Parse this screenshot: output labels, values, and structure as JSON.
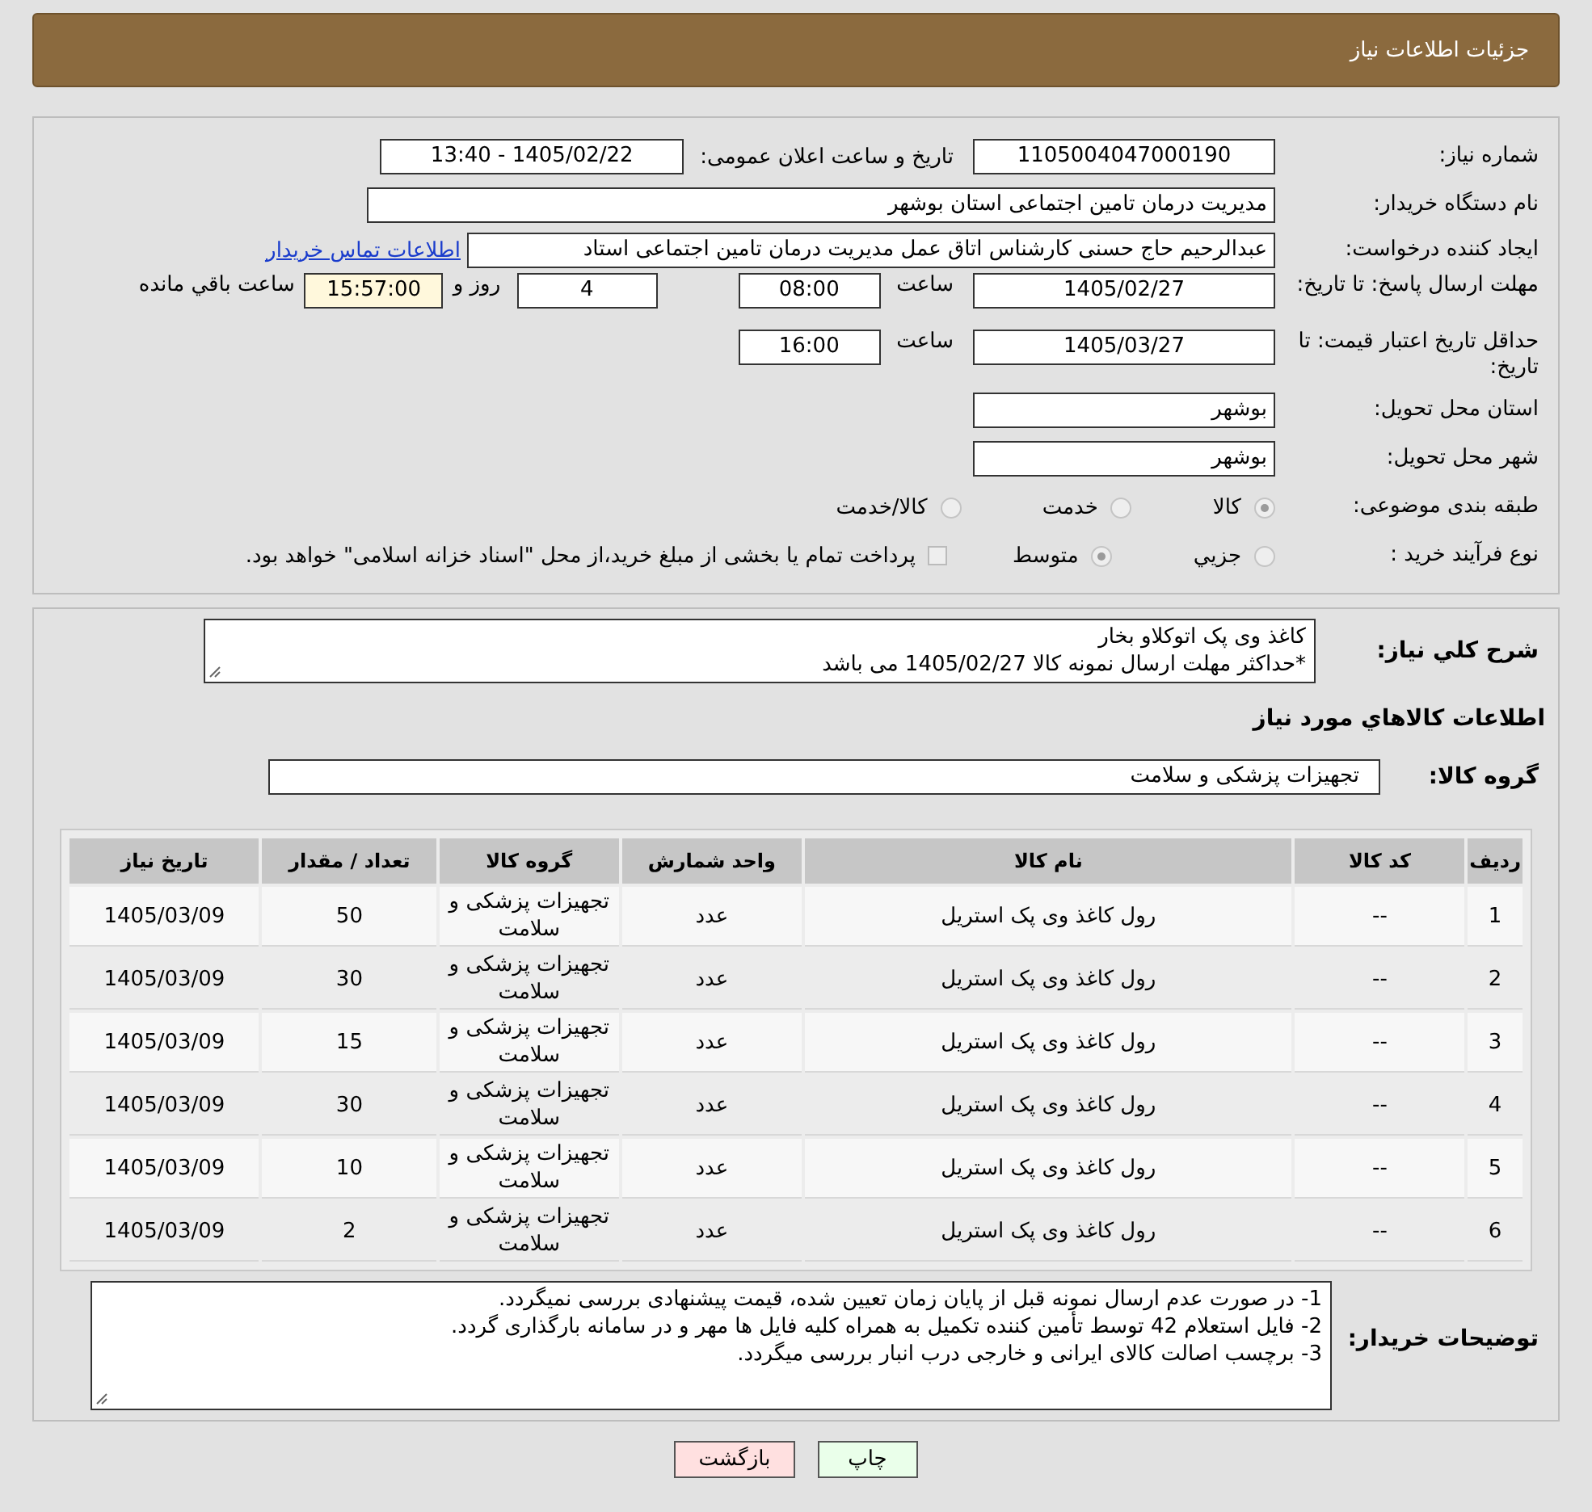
{
  "header": {
    "title": "جزئیات اطلاعات نیاز"
  },
  "fields": [
    {
      "kind": "pair",
      "label": "شماره نیاز:",
      "value": "1105004047000190",
      "label2": "تاریخ و ساعت اعلان عمومی:",
      "value2": "1405/02/22 - 13:40"
    },
    {
      "kind": "wide",
      "label": "نام دستگاه خریدار:",
      "value": "مدیریت درمان تامین اجتماعی استان بوشهر"
    },
    {
      "kind": "link",
      "label": "ایجاد کننده درخواست:",
      "value": "عبدالرحیم حاج حسنی کارشناس اتاق عمل مدیریت درمان تامین اجتماعی استاد",
      "link": "اطلاعات تماس خریدار"
    },
    {
      "kind": "deadline",
      "label": "مهلت ارسال پاسخ: تا تاریخ:",
      "value": "1405/02/27",
      "time_label": "ساعت",
      "time": "08:00",
      "days": "4",
      "days_label": "روز و",
      "remaining": "15:57:00",
      "remaining_label": "ساعت باقي مانده"
    },
    {
      "kind": "deadline",
      "label": "حداقل تاریخ اعتبار قیمت: تا تاریخ:",
      "value": "1405/03/27",
      "time_label": "ساعت",
      "time": "16:00"
    },
    {
      "kind": "short",
      "label": "استان محل تحویل:",
      "value": "بوشهر"
    },
    {
      "kind": "short",
      "label": "شهر محل تحویل:",
      "value": "بوشهر"
    },
    {
      "kind": "radios",
      "label": "طبقه بندی موضوعی:",
      "options": [
        {
          "label": "کالا",
          "selected": true
        },
        {
          "label": "خدمت",
          "selected": false
        },
        {
          "label": "کالا/خدمت",
          "selected": false
        }
      ]
    },
    {
      "kind": "radios",
      "label": "نوع فرآیند خرید :",
      "options": [
        {
          "label": "جزیي",
          "selected": false
        },
        {
          "label": "متوسط",
          "selected": true
        }
      ],
      "check": {
        "label": "پرداخت تمام یا بخشی از مبلغ خرید،از محل \"اسناد خزانه اسلامی\" خواهد بود.",
        "checked": false
      }
    }
  ],
  "description": {
    "label": "شرح کلي نیاز:",
    "lines": [
      "کاغذ وی پک اتوکلاو بخار",
      "*حداکثر مهلت ارسال نمونه کالا 1405/02/27 می باشد"
    ]
  },
  "goods_title": "اطلاعات کالاهاي مورد نیاز",
  "goods_group": {
    "label": "گروه کالا:",
    "value": "تجهیزات پزشکی و سلامت"
  },
  "table": {
    "columns": [
      "ردیف",
      "کد کالا",
      "نام کالا",
      "واحد شمارش",
      "گروه کالا",
      "تعداد / مقدار",
      "تاریخ نیاز"
    ],
    "rows": [
      [
        "1",
        "--",
        "رول کاغذ وی پک استریل",
        "عدد",
        "تجهیزات پزشکی و سلامت",
        "50",
        "1405/03/09"
      ],
      [
        "2",
        "--",
        "رول کاغذ وی پک استریل",
        "عدد",
        "تجهیزات پزشکی و سلامت",
        "30",
        "1405/03/09"
      ],
      [
        "3",
        "--",
        "رول کاغذ وی پک استریل",
        "عدد",
        "تجهیزات پزشکی و سلامت",
        "15",
        "1405/03/09"
      ],
      [
        "4",
        "--",
        "رول کاغذ وی پک استریل",
        "عدد",
        "تجهیزات پزشکی و سلامت",
        "30",
        "1405/03/09"
      ],
      [
        "5",
        "--",
        "رول کاغذ وی پک استریل",
        "عدد",
        "تجهیزات پزشکی و سلامت",
        "10",
        "1405/03/09"
      ],
      [
        "6",
        "--",
        "رول کاغذ وی پک استریل",
        "عدد",
        "تجهیزات پزشکی و سلامت",
        "2",
        "1405/03/09"
      ]
    ]
  },
  "buyer_notes": {
    "label": "توضیحات خریدار:",
    "lines": [
      "1- در صورت عدم ارسال نمونه قبل از پایان زمان تعیین شده، قیمت پیشنهادی بررسی نمیگردد.",
      "2- فایل استعلام 42 توسط تأمین کننده تکمیل به همراه کلیه فایل ها مهر و در سامانه بارگذاری گردد.",
      "3- برچسب اصالت کالای ایرانی و خارجی درب انبار بررسی میگردد."
    ]
  },
  "buttons": [
    {
      "kind": "print",
      "label": "چاپ"
    },
    {
      "kind": "back",
      "label": "بازگشت"
    }
  ]
}
